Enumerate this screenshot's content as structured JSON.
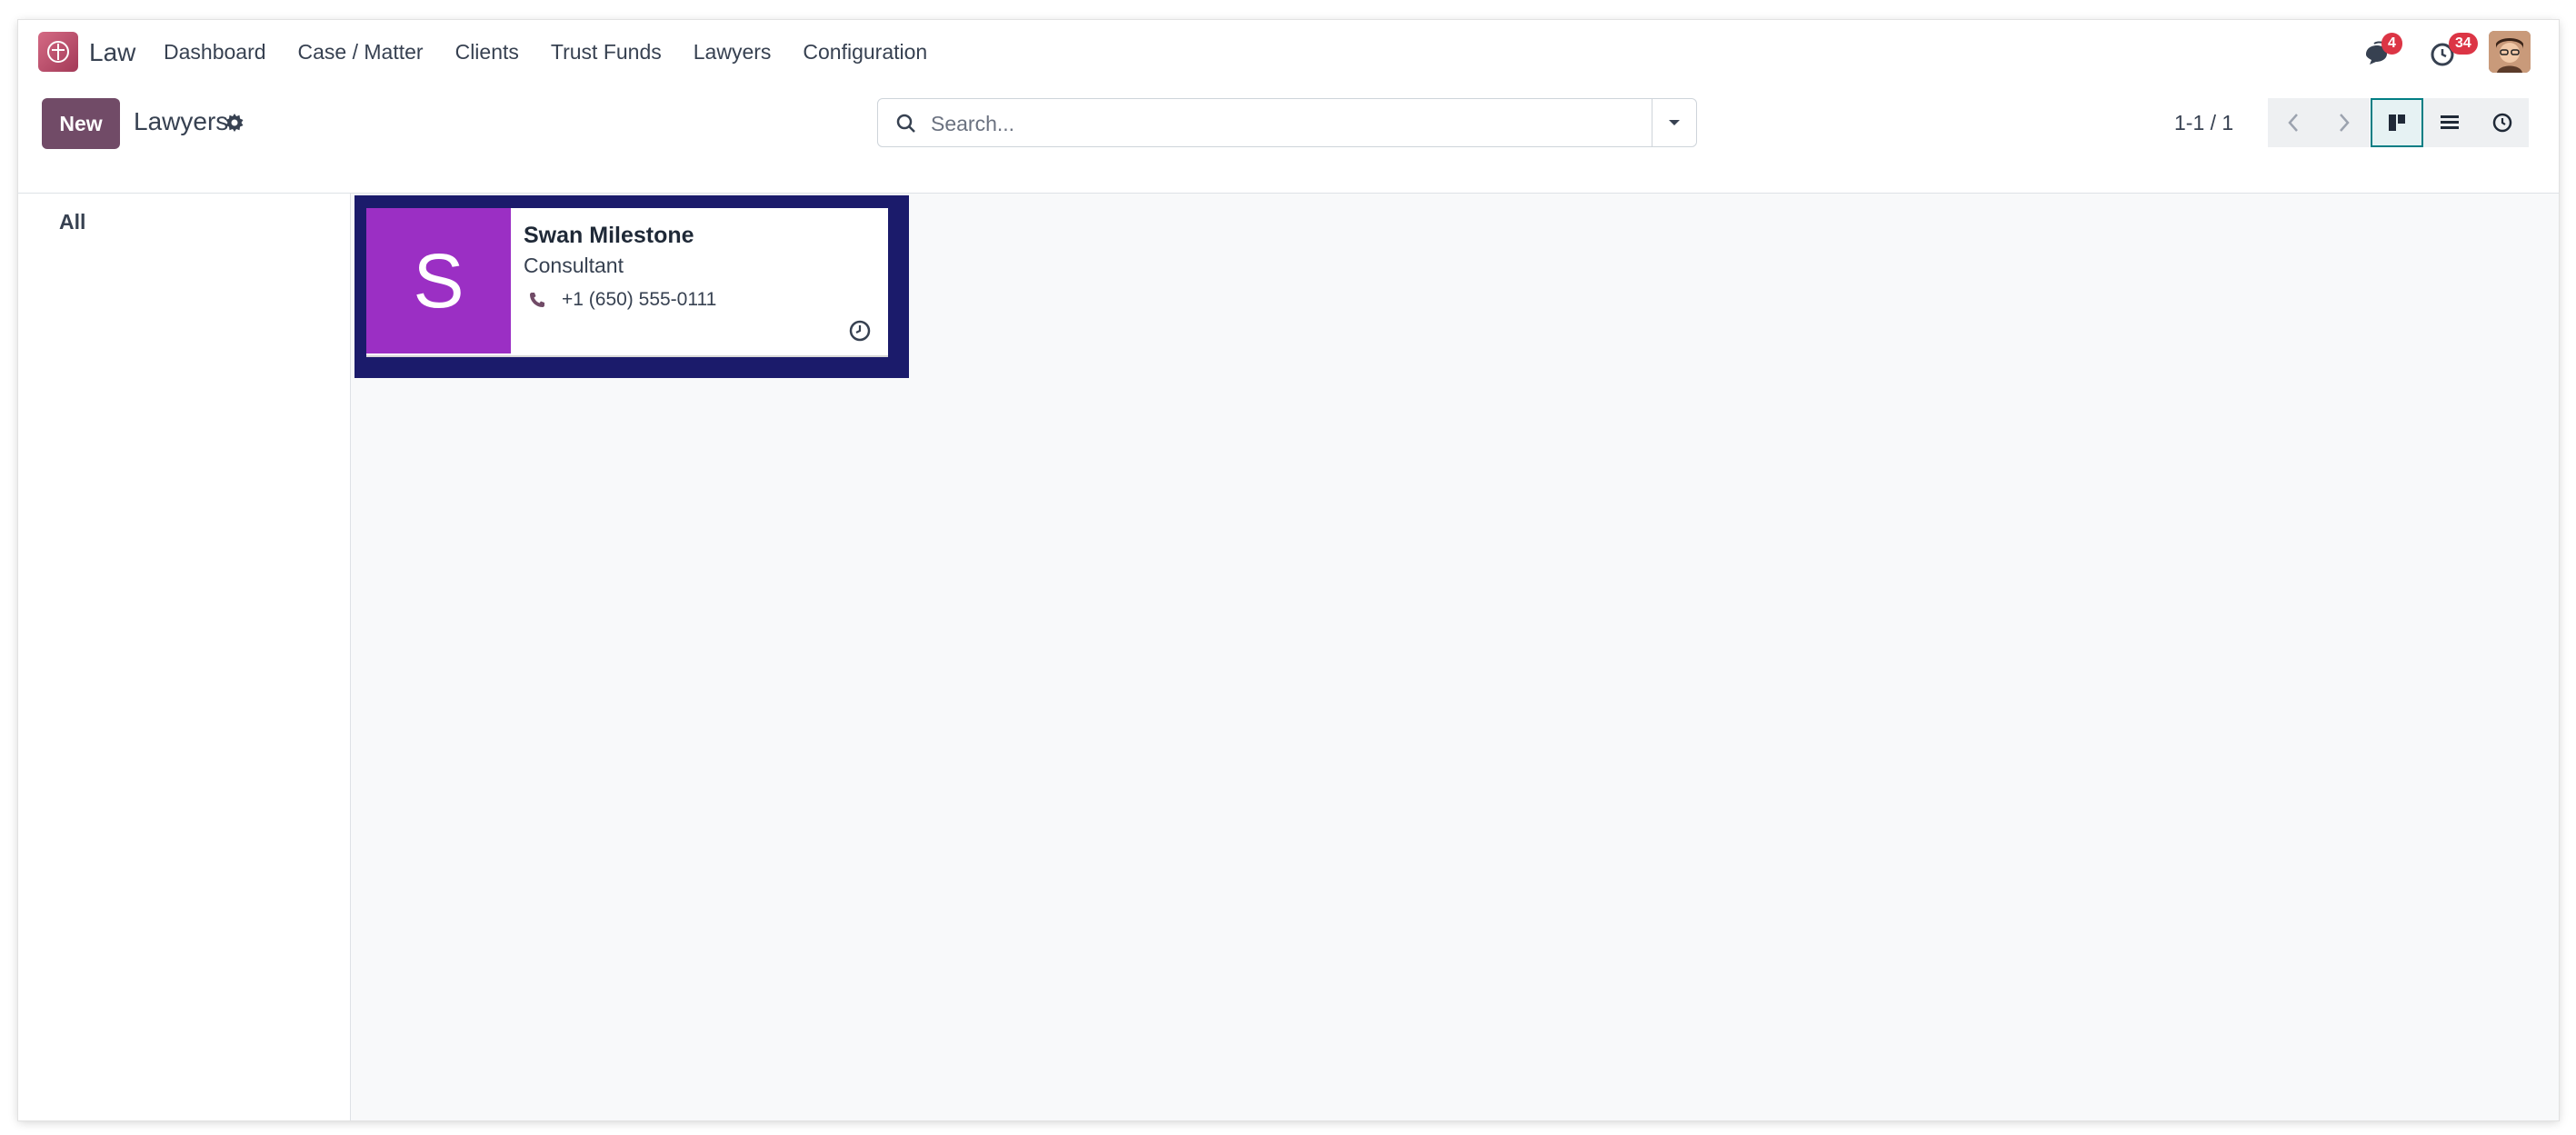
{
  "app": {
    "name": "Law",
    "menu": [
      "Dashboard",
      "Case / Matter",
      "Clients",
      "Trust Funds",
      "Lawyers",
      "Configuration"
    ],
    "messages_badge": "4",
    "activities_badge": "34"
  },
  "control": {
    "new_label": "New",
    "title": "Lawyers",
    "search_placeholder": "Search...",
    "pager": "1-1 / 1"
  },
  "sidebar": {
    "all_label": "All"
  },
  "records": [
    {
      "initial": "S",
      "name": "Swan Milestone",
      "job": "Consultant",
      "phone": "+1 (650) 555-0111",
      "avatar_color": "#9b2fc4"
    }
  ],
  "colors": {
    "brand": "#714b67",
    "active_view": "#017e84",
    "badge": "#dc3545",
    "focus_outline": "#1b1b6b"
  }
}
